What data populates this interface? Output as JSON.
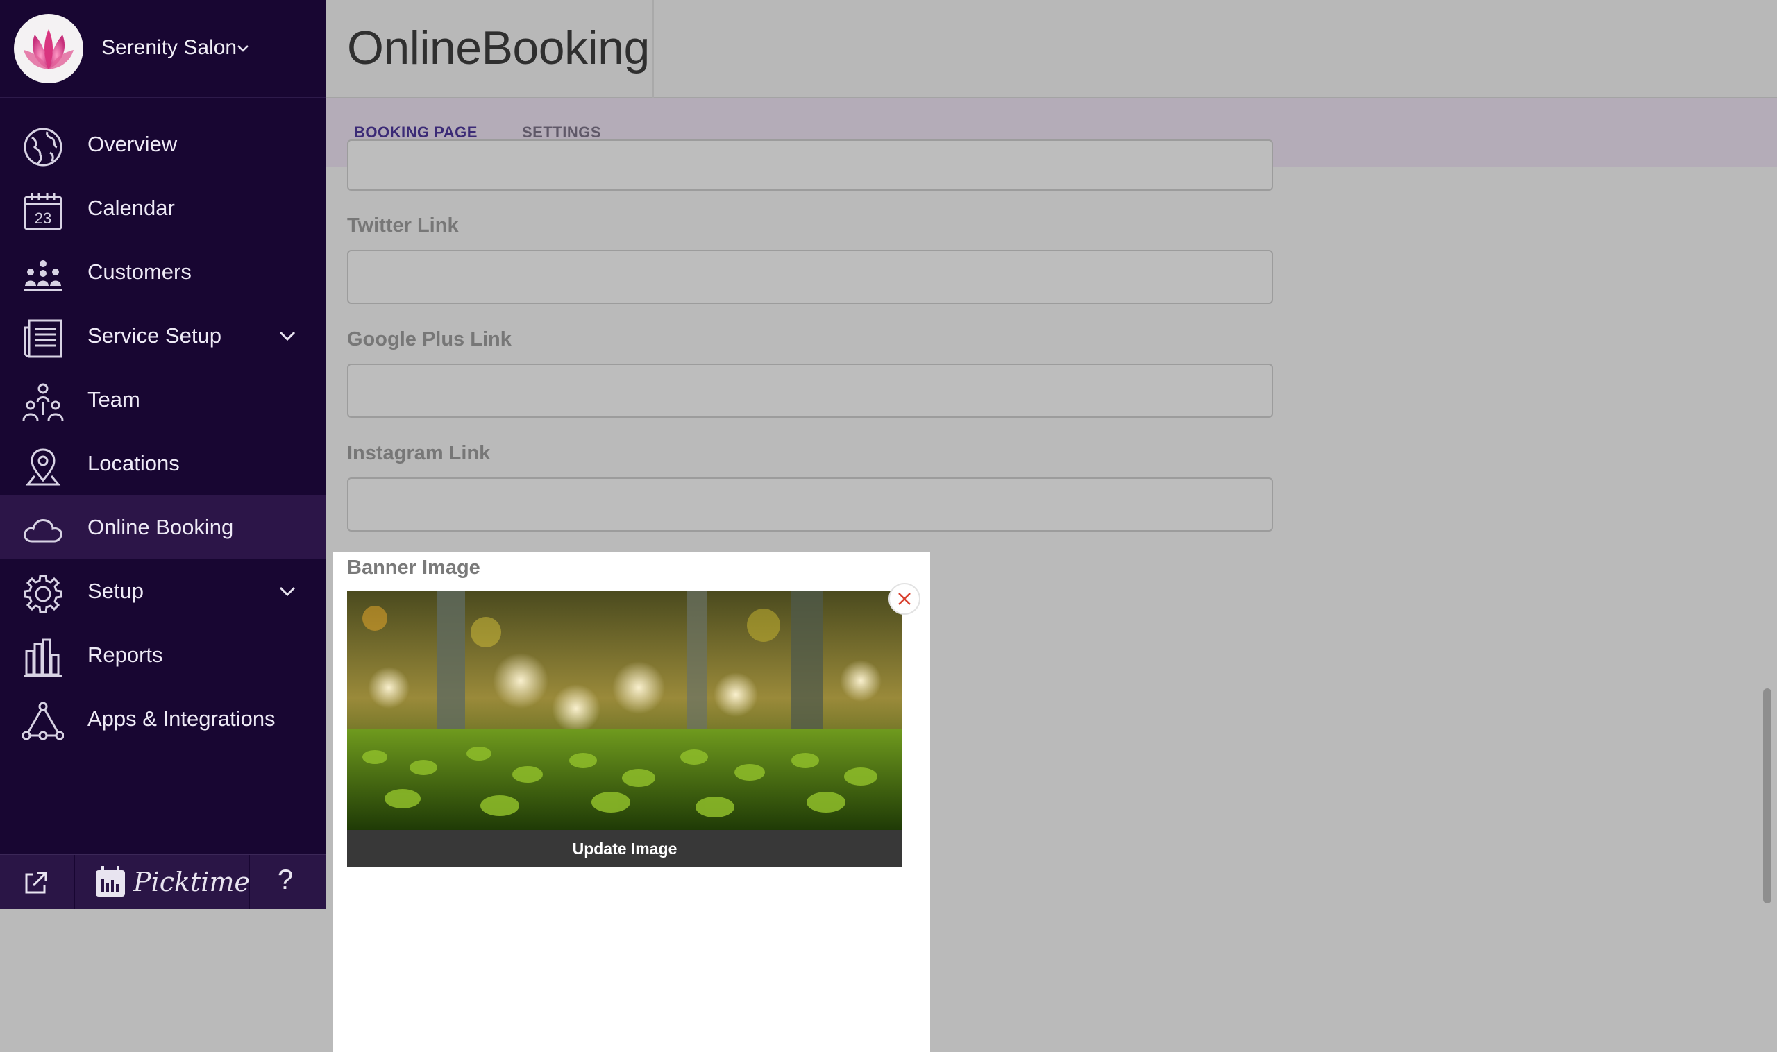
{
  "account": {
    "name": "Serenity Salon"
  },
  "sidebar": {
    "items": [
      {
        "label": "Overview",
        "icon": "globe-icon"
      },
      {
        "label": "Calendar",
        "icon": "calendar-icon",
        "icon_text": "23"
      },
      {
        "label": "Customers",
        "icon": "customers-icon"
      },
      {
        "label": "Service Setup",
        "icon": "service-list-icon",
        "expandable": true
      },
      {
        "label": "Team",
        "icon": "team-icon"
      },
      {
        "label": "Locations",
        "icon": "location-pin-icon"
      },
      {
        "label": "Online Booking",
        "icon": "cloud-icon",
        "active": true
      },
      {
        "label": "Setup",
        "icon": "gear-icon",
        "expandable": true
      },
      {
        "label": "Reports",
        "icon": "bar-chart-icon"
      },
      {
        "label": "Apps & Integrations",
        "icon": "triangle-nodes-icon"
      }
    ],
    "footer": {
      "brand": "Picktime",
      "help": "?"
    }
  },
  "header": {
    "title": "OnlineBooking"
  },
  "tabs": [
    {
      "label": "BOOKING PAGE",
      "active": false
    },
    {
      "label": "SETTINGS",
      "active": true
    }
  ],
  "form": {
    "fields": [
      {
        "label": "Twitter Link",
        "value": ""
      },
      {
        "label": "Google Plus Link",
        "value": ""
      },
      {
        "label": "Instagram Link",
        "value": ""
      }
    ],
    "banner": {
      "label": "Banner Image",
      "update_label": "Update Image"
    }
  },
  "colors": {
    "sidebar_bg": "#180632",
    "sidebar_active": "#2c1548",
    "accent": "#3b2a76",
    "overlay_gray": "#bababa"
  }
}
